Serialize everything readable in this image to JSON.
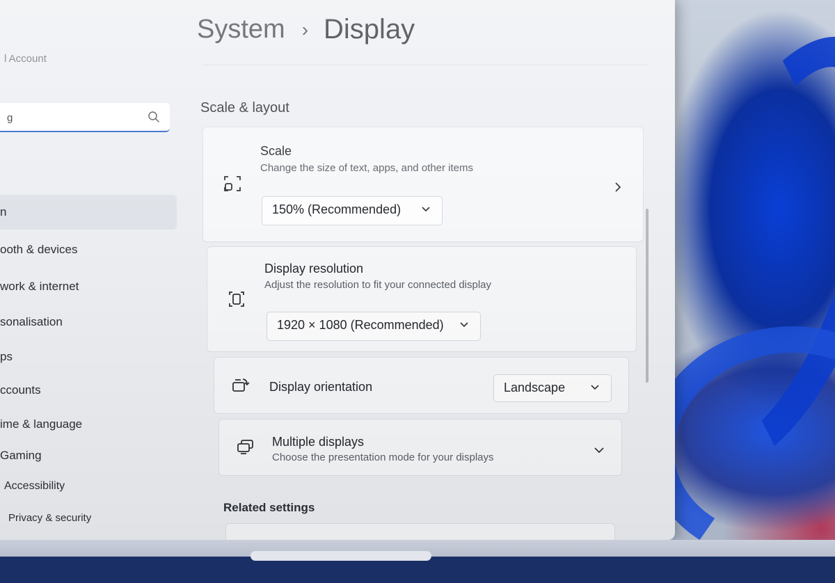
{
  "sidebar": {
    "account_label": "l Account",
    "search": {
      "value": "g",
      "placeholder": ""
    },
    "items": [
      {
        "label": "n",
        "active": true
      },
      {
        "label": "ooth & devices"
      },
      {
        "label": "work & internet"
      },
      {
        "label": "sonalisation"
      },
      {
        "label": "ps"
      },
      {
        "label": "ccounts"
      },
      {
        "label": "ime & language"
      },
      {
        "label": "Gaming"
      },
      {
        "label": "Accessibility"
      },
      {
        "label": "Privacy & security"
      }
    ]
  },
  "header": {
    "breadcrumb_parent": "System",
    "breadcrumb_separator": "›",
    "breadcrumb_current": "Display"
  },
  "section": {
    "title": "Scale & layout"
  },
  "cards": {
    "scale": {
      "title": "Scale",
      "description": "Change the size of text, apps, and other items",
      "dropdown_value": "150% (Recommended)",
      "icon": "scale-icon"
    },
    "resolution": {
      "title": "Display resolution",
      "description": "Adjust the resolution to fit your connected display",
      "dropdown_value": "1920 × 1080 (Recommended)",
      "icon": "resolution-icon"
    },
    "orientation": {
      "title": "Display orientation",
      "dropdown_value": "Landscape",
      "icon": "orientation-icon"
    },
    "multiple": {
      "title": "Multiple displays",
      "description": "Choose the presentation mode for your displays",
      "icon": "multiple-displays-icon"
    }
  },
  "related": {
    "title": "Related settings"
  },
  "colors": {
    "accent": "#2d63c9",
    "window_bg": "#eceef2",
    "card_bg": "#f6f7f9"
  }
}
